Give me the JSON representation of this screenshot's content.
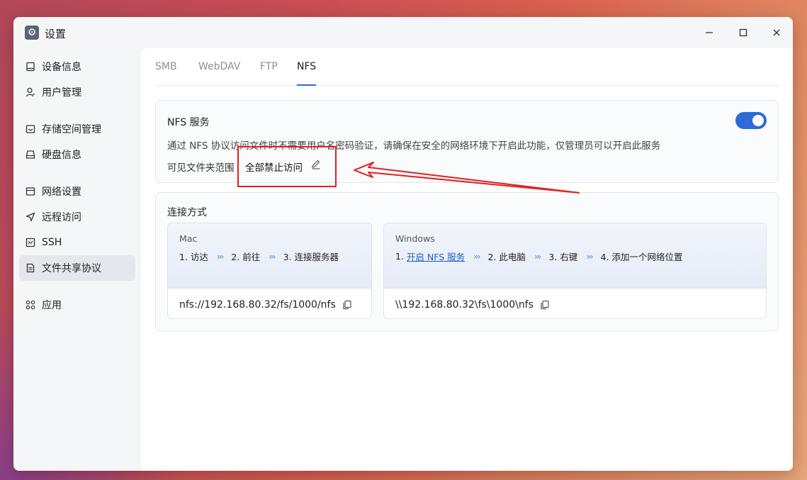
{
  "window": {
    "title": "设置"
  },
  "titlebar": {
    "minimize": "—",
    "maximize": "☐",
    "close": "✕"
  },
  "sidebar": {
    "items": [
      {
        "label": "设备信息",
        "icon": "device-icon"
      },
      {
        "label": "用户管理",
        "icon": "user-icon"
      },
      {
        "label": "存储空间管理",
        "icon": "storage-icon"
      },
      {
        "label": "硬盘信息",
        "icon": "disk-icon"
      },
      {
        "label": "网络设置",
        "icon": "network-icon"
      },
      {
        "label": "远程访问",
        "icon": "send-icon"
      },
      {
        "label": "SSH",
        "icon": "terminal-icon"
      },
      {
        "label": "文件共享协议",
        "icon": "document-icon",
        "active": true
      },
      {
        "label": "应用",
        "icon": "apps-icon"
      }
    ]
  },
  "tabs": [
    {
      "label": "SMB"
    },
    {
      "label": "WebDAV"
    },
    {
      "label": "FTP"
    },
    {
      "label": "NFS",
      "active": true
    }
  ],
  "nfs_service": {
    "title": "NFS 服务",
    "enabled": true,
    "description": "通过 NFS 协议访问文件时不需要用户名密码验证，请确保在安全的网络环境下开启此功能，仅管理员可以开启此服务",
    "scope_label": "可见文件夹范围",
    "scope_value": "全部禁止访问"
  },
  "connection": {
    "title": "连接方式",
    "mac": {
      "os": "Mac",
      "steps": [
        "1. 访达",
        "2. 前往",
        "3. 连接服务器"
      ],
      "path": "nfs://192.168.80.32/fs/1000/nfs"
    },
    "windows": {
      "os": "Windows",
      "step1_prefix": "1. ",
      "step1_link": "开启 NFS 服务",
      "steps": [
        "2. 此电脑",
        "3. 右键",
        "4. 添加一个网络位置"
      ],
      "path": "\\\\192.168.80.32\\fs\\1000\\nfs"
    }
  },
  "colors": {
    "accent": "#2c6bd8",
    "annotation": "#e02020"
  }
}
